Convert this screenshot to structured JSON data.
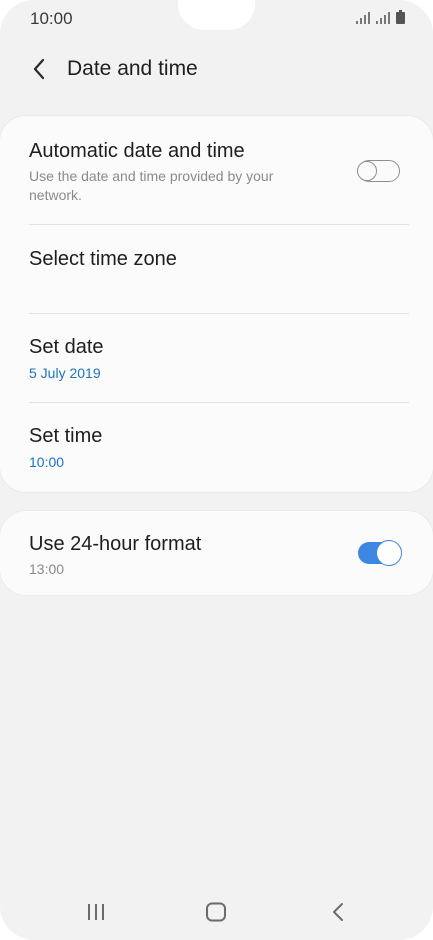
{
  "status_bar": {
    "time": "10:00"
  },
  "header": {
    "title": "Date and time"
  },
  "settings": {
    "automatic": {
      "title": "Automatic date and time",
      "subtitle": "Use the date and time provided by your network.",
      "enabled": false
    },
    "time_zone": {
      "title": "Select time zone"
    },
    "set_date": {
      "title": "Set date",
      "value": "5 July 2019"
    },
    "set_time": {
      "title": "Set time",
      "value": "10:00"
    },
    "format_24h": {
      "title": "Use 24-hour format",
      "subtitle": "13:00",
      "enabled": true
    }
  },
  "colors": {
    "accent": "#3e87e0",
    "value_text": "#1b74c2",
    "background": "#f2f2f2"
  }
}
